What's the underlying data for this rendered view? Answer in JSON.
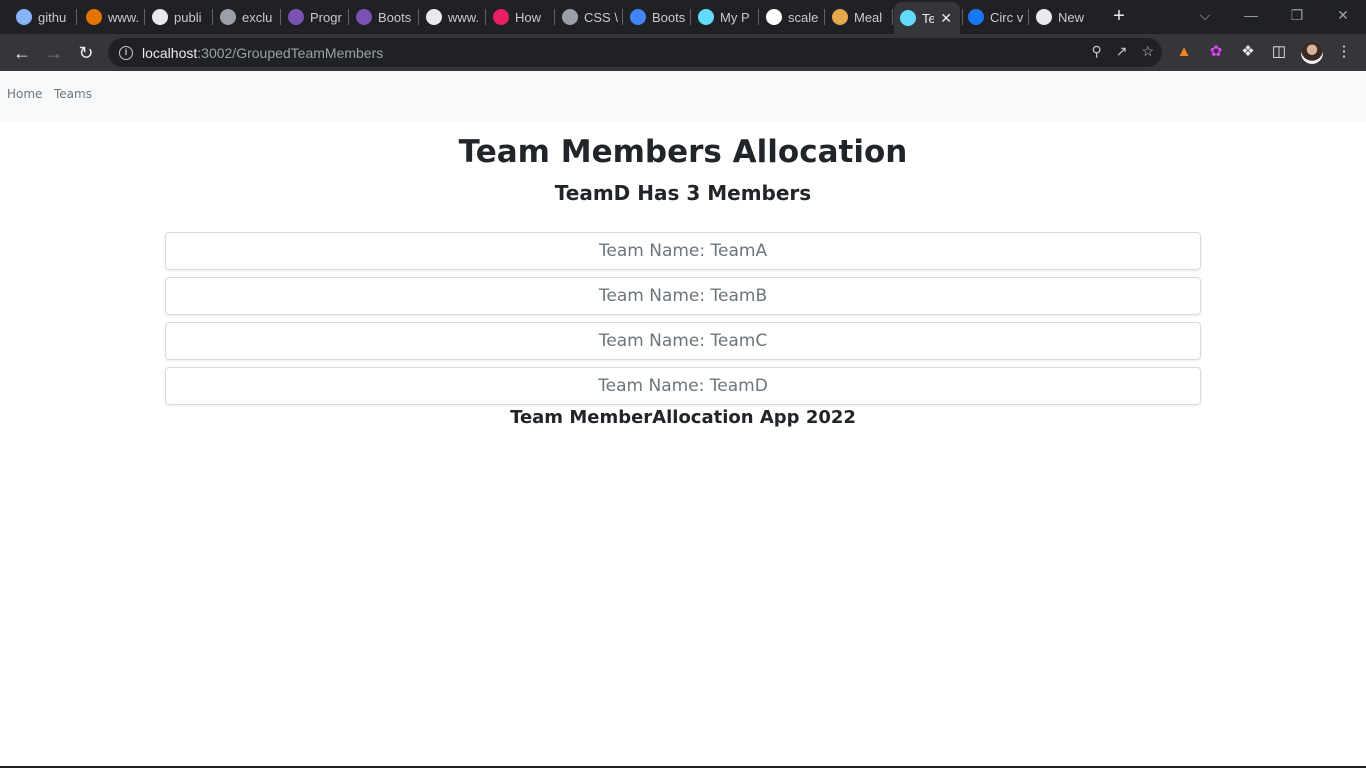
{
  "browser": {
    "tabs": [
      {
        "title": "githu",
        "icon": "globe-icon",
        "color": "#8ab4f8"
      },
      {
        "title": "www.",
        "icon": "noodle-icon",
        "color": "#e37400"
      },
      {
        "title": "publi",
        "icon": "github-icon",
        "color": "#e8eaed"
      },
      {
        "title": "exclu",
        "icon": "circle-logo-icon",
        "color": "#9aa0a6"
      },
      {
        "title": "Progr",
        "icon": "bootstrap-icon",
        "color": "#7952b3"
      },
      {
        "title": "Boots",
        "icon": "bootstrap-icon",
        "color": "#7952b3"
      },
      {
        "title": "www.",
        "icon": "n-logo-icon",
        "color": "#e8eaed"
      },
      {
        "title": "How",
        "icon": "play-icon",
        "color": "#e91e63"
      },
      {
        "title": "CSS \\",
        "icon": "globe-icon",
        "color": "#9aa0a6"
      },
      {
        "title": "Boots",
        "icon": "cloud-icon",
        "color": "#4285f4"
      },
      {
        "title": "My P",
        "icon": "react-icon",
        "color": "#61dafb"
      },
      {
        "title": "scale",
        "icon": "m-logo-icon",
        "color": "#ffffff"
      },
      {
        "title": "Meal",
        "icon": "food-icon",
        "color": "#e4a84e"
      },
      {
        "title": "Te",
        "icon": "react-icon",
        "color": "#61dafb"
      },
      {
        "title": "Circ v",
        "icon": "facebook-icon",
        "color": "#1877f2"
      },
      {
        "title": "New",
        "icon": "chrome-icon",
        "color": "#e8eaed"
      }
    ],
    "active_tab_index": 13,
    "new_tab_symbol": "+",
    "url_host": "localhost",
    "url_path": ":3002/GroupedTeamMembers"
  },
  "navbar": {
    "home": "Home",
    "teams": "Teams"
  },
  "page": {
    "title": "Team Members Allocation",
    "subtitle": "TeamD Has 3 Members",
    "teams": [
      "Team Name: TeamA",
      "Team Name: TeamB",
      "Team Name: TeamC",
      "Team Name: TeamD"
    ],
    "footer": "Team MemberAllocation App 2022"
  }
}
